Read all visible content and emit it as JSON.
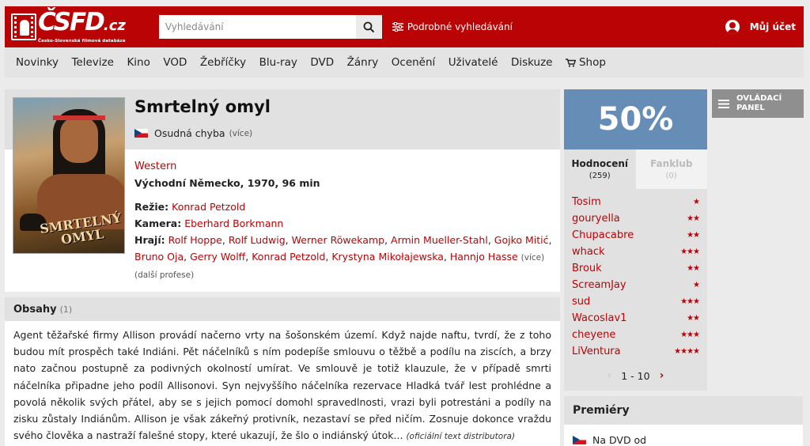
{
  "header": {
    "logo_text": "ČSFD",
    "logo_suffix": ".cz",
    "logo_tagline": "Česko-Slovenská filmová databáze",
    "search_placeholder": "Vyhledávání",
    "advanced_search": "Podrobné vyhledávání",
    "account": "Můj účet"
  },
  "nav": [
    "Novinky",
    "Televize",
    "Kino",
    "VOD",
    "Žebříčky",
    "Blu-ray",
    "DVD",
    "Žánry",
    "Ocenění",
    "Uživatelé",
    "Diskuze",
    "Shop"
  ],
  "film": {
    "title": "Smrtelný omyl",
    "original_title": "Osudná chyba",
    "more": "(více)",
    "genre": "Western",
    "origin": "Východní Německo, 1970, 96 min",
    "director_label": "Režie:",
    "director": "Konrad Petzold",
    "camera_label": "Kamera:",
    "camera": "Eberhard Borkmann",
    "cast_label": "Hrají:",
    "cast": [
      "Rolf Hoppe",
      "Rolf Ludwig",
      "Werner Röwekamp",
      "Armin Mueller-Stahl",
      "Gojko Mitić",
      "Bruno Oja",
      "Gerry Wolff",
      "Konrad Petzold",
      "Krystyna Mikołajewska",
      "Hannjo Hasse"
    ],
    "cast_more": "(více)",
    "more_professions": "(další profese)",
    "poster_title": "SMRTELNÝ OMYL"
  },
  "synopsis": {
    "heading": "Obsahy",
    "count": "(1)",
    "text": "Agent těžařské firmy Allison provádí načerno vrty na šošonském území. Když najde naftu, tvrdí, že z toho budou mít prospěch také Indiáni. Pět náčelníků s ním podepíše smlouvu o těžbě a podílu na ziscích, a brzy nato začnou postupně za podivných okolností umírat. Ve smlouvě je totiž klauzule, že v případě smrti náčelníka připadne jeho podíl Allisonovi. Syn nejvyššího náčelníka rezervace Hladká tvář lest prohlédne a povolá několik svých přátel, aby se s jejich pomocí domohl spravedlnosti, vrazi byli potrestáni a podíly na zisku zůstaly Indiánům. Allison je však zákeřný protivník, nezastaví se před ničím. Zosnuje dokonce vraždu svého člověka a nastraží falešné stopy, které ukazují, že šlo o indiánský útok...",
    "source": "(oficiální text distributora)"
  },
  "rating": {
    "percent": "50%",
    "percent_value": 50,
    "color": "#658db5",
    "tabs": [
      {
        "label": "Hodnocení",
        "count": "(259)"
      },
      {
        "label": "Fanklub",
        "count": "(0)"
      }
    ],
    "users": [
      {
        "name": "Tosim",
        "stars": 1
      },
      {
        "name": "gouryella",
        "stars": 2
      },
      {
        "name": "Chupacabre",
        "stars": 2
      },
      {
        "name": "whack",
        "stars": 3
      },
      {
        "name": "Brouk",
        "stars": 2
      },
      {
        "name": "ScreamJay",
        "stars": 1
      },
      {
        "name": "sud",
        "stars": 3
      },
      {
        "name": "Wacoslav1",
        "stars": 2
      },
      {
        "name": "cheyene",
        "stars": 3
      },
      {
        "name": "LiVentura",
        "stars": 4
      }
    ],
    "pager": "1 - 10"
  },
  "premieres": {
    "heading": "Premiéry",
    "row": "Na DVD od"
  },
  "control_panel": {
    "label_line1": "OVLÁDACÍ",
    "label_line2": "PANEL"
  },
  "colors": {
    "brand_red": "#ba0305",
    "rating_blue": "#658db5"
  }
}
